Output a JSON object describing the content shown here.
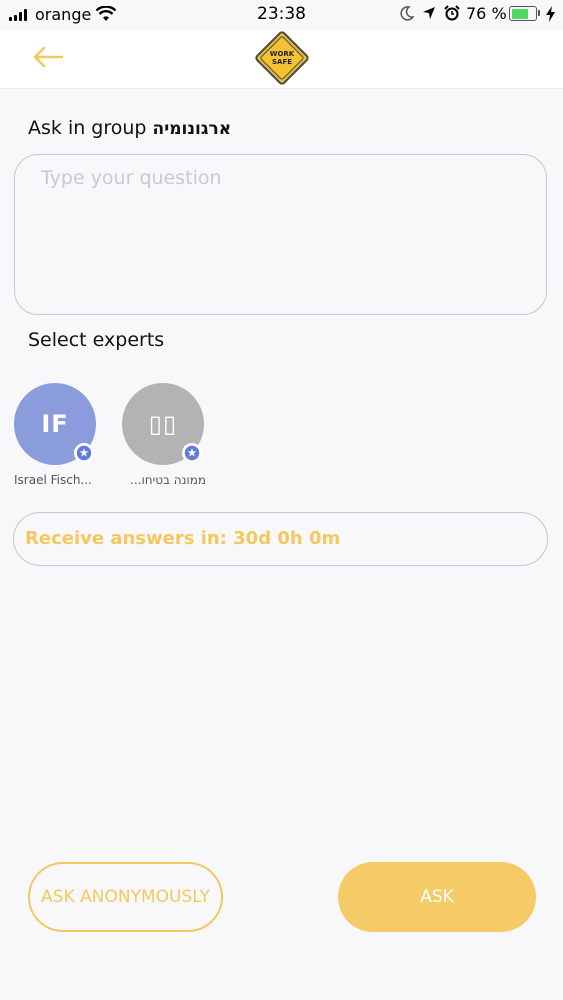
{
  "status_bar": {
    "carrier": "orange",
    "time": "23:38",
    "battery": "76 %",
    "battery_level": 0.76
  },
  "header": {
    "back_icon": "arrow-left-icon",
    "logo_line1": "WORK",
    "logo_line2": "SAFE"
  },
  "ask": {
    "title_prefix": "Ask in group ",
    "group_name": "ארגונומיה",
    "placeholder": "Type your question"
  },
  "experts": {
    "title": "Select experts",
    "items": [
      {
        "initials": "IF",
        "name": "Israel Fisch...",
        "color": "#8b9cdc"
      },
      {
        "initials": "▯▯",
        "name": "ממונה בטיחו...",
        "color": "#b3b3b5"
      }
    ]
  },
  "receive": {
    "text": "Receive answers in: 30d 0h 0m"
  },
  "buttons": {
    "anonymous": "ASK ANONYMOUSLY",
    "ask": "ASK"
  },
  "colors": {
    "accent": "#f3c95f",
    "ask_button": "#f5cb67",
    "star": "#5b7be0"
  }
}
